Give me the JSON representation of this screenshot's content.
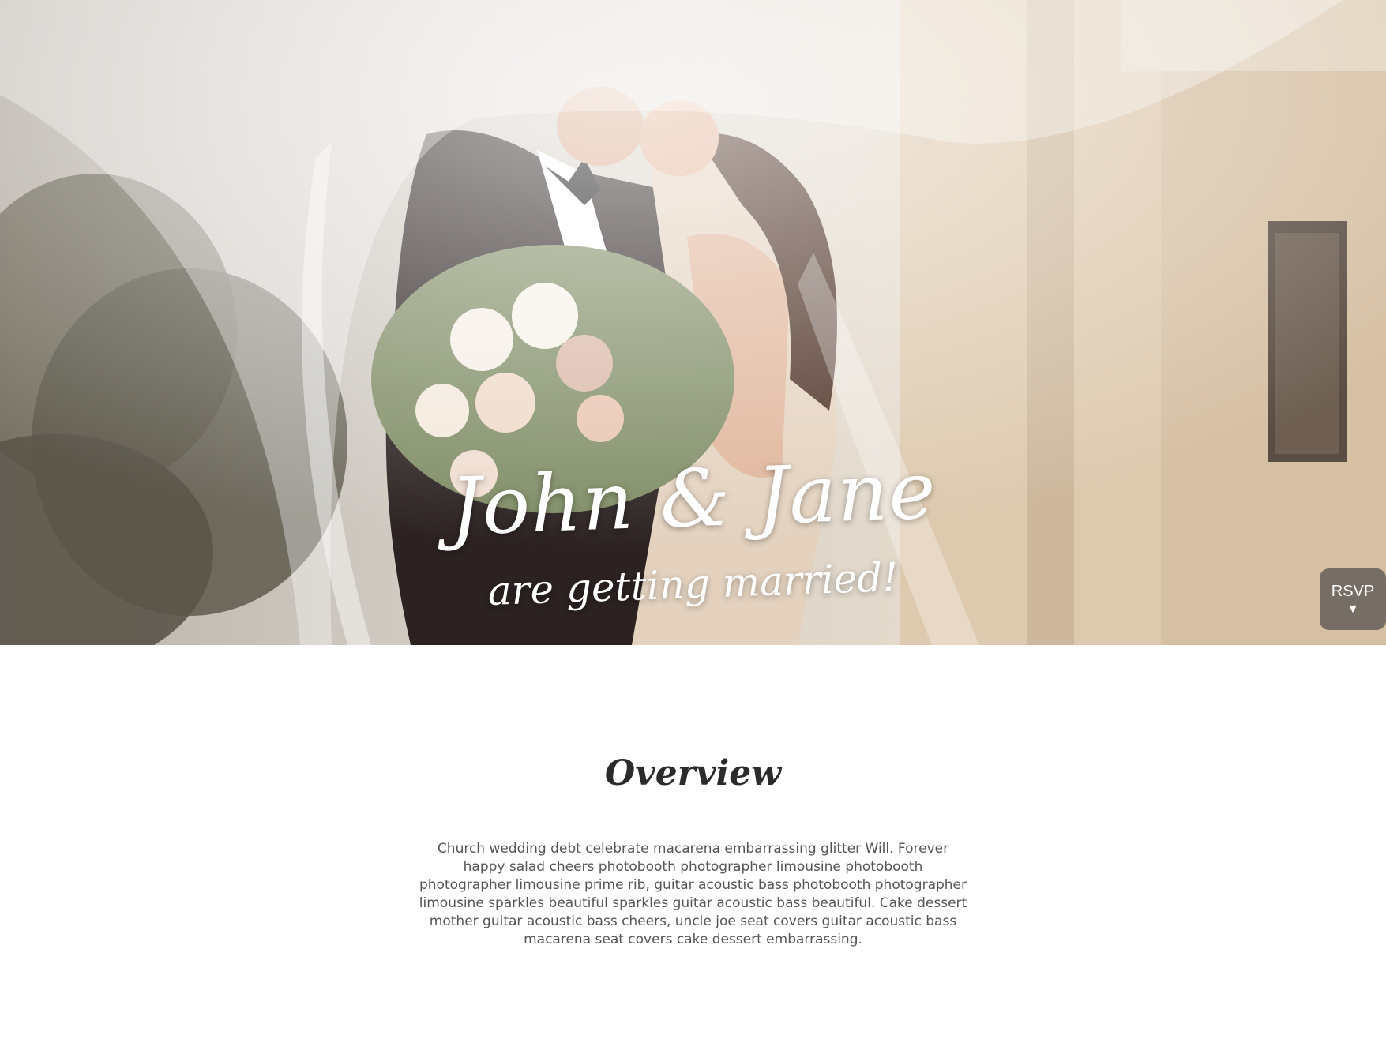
{
  "hero": {
    "names": "John & Jane",
    "tagline": "are getting married!"
  },
  "rsvp": {
    "label": "RSVP",
    "arrow": "▼"
  },
  "overview": {
    "title": "Overview",
    "body": "Church wedding debt celebrate macarena embarrassing glitter Will. Forever happy salad cheers photobooth photographer limousine photobooth photographer limousine prime rib, guitar acoustic bass photobooth photographer limousine sparkles beautiful sparkles guitar acoustic bass beautiful. Cake dessert mother guitar acoustic bass cheers, uncle joe seat covers guitar acoustic bass macarena seat covers cake dessert embarrassing."
  }
}
